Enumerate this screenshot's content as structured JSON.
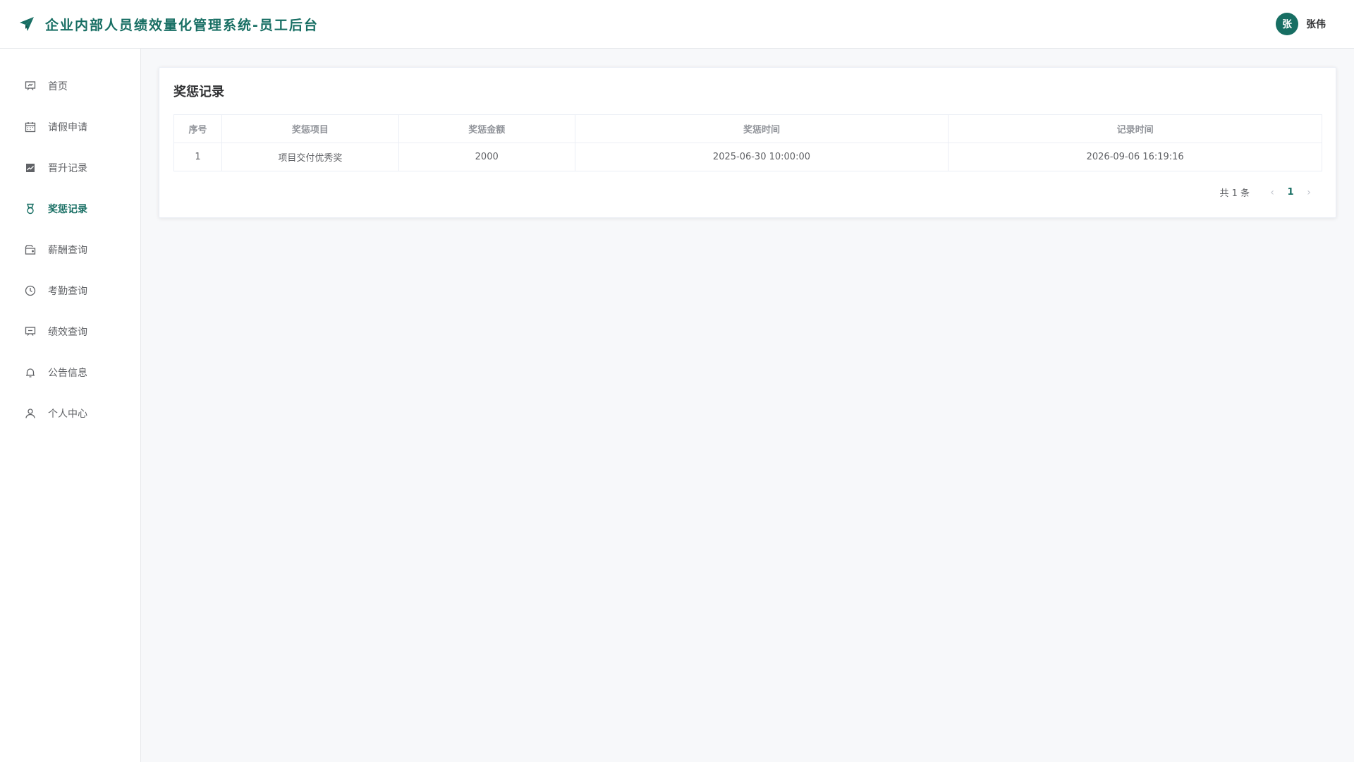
{
  "header": {
    "title": "企业内部人员绩效量化管理系统-员工后台",
    "avatar_char": "张",
    "username": "张伟",
    "logo_icon": "paper-plane-icon"
  },
  "sidebar": {
    "items": [
      {
        "label": "首页",
        "icon": "presentation-icon",
        "active": false
      },
      {
        "label": "请假申请",
        "icon": "calendar-icon",
        "active": false
      },
      {
        "label": "晋升记录",
        "icon": "chart-icon",
        "active": false
      },
      {
        "label": "奖惩记录",
        "icon": "medal-icon",
        "active": true
      },
      {
        "label": "薪酬查询",
        "icon": "wallet-icon",
        "active": false
      },
      {
        "label": "考勤查询",
        "icon": "clock-icon",
        "active": false
      },
      {
        "label": "绩效查询",
        "icon": "board-icon",
        "active": false
      },
      {
        "label": "公告信息",
        "icon": "bell-icon",
        "active": false
      },
      {
        "label": "个人中心",
        "icon": "user-icon",
        "active": false
      }
    ]
  },
  "main": {
    "title": "奖惩记录",
    "table": {
      "headers": [
        "序号",
        "奖惩项目",
        "奖惩金额",
        "奖惩时间",
        "记录时间"
      ],
      "rows": [
        [
          "1",
          "项目交付优秀奖",
          "2000",
          "2025-06-30 10:00:00",
          "2026-09-06 16:19:16"
        ]
      ]
    },
    "pagination": {
      "total": "共 1 条",
      "current_page": "1",
      "prev": "‹",
      "next": "›"
    }
  },
  "colors": {
    "accent": "#176e63",
    "background": "#f7f8fa"
  }
}
